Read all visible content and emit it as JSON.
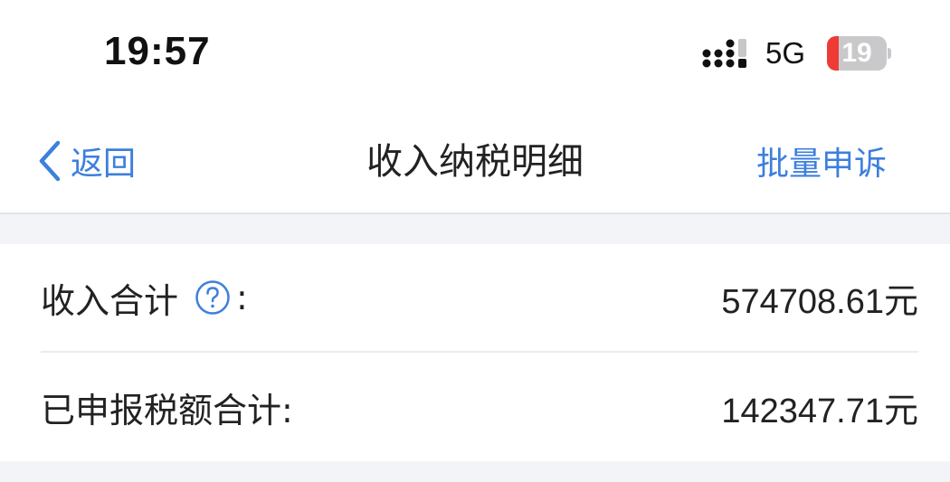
{
  "status_bar": {
    "time": "19:57",
    "network": "5G",
    "battery_level": "19",
    "battery_color": "#ef3b36"
  },
  "nav": {
    "back_label": "返回",
    "title": "收入纳税明细",
    "action_label": "批量申诉",
    "accent_color": "#3d7fdc"
  },
  "summary": {
    "income_total_label": "收入合计",
    "income_total_colon": ":",
    "income_total_value": "574708.61元",
    "tax_declared_label": "已申报税额合计:",
    "tax_declared_value": "142347.71元"
  },
  "icons": {
    "back": "chevron-left-icon",
    "help": "question-circle-icon",
    "signal": "cellular-signal-icon",
    "battery": "battery-icon"
  }
}
